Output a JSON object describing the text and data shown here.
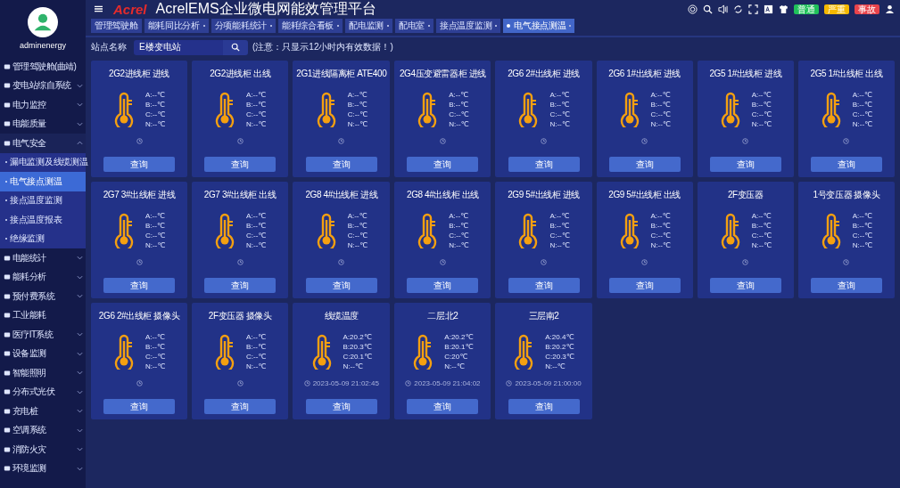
{
  "sidebar": {
    "user": "adminenergy",
    "items": [
      {
        "label": "管理驾驶舱(曲靖)",
        "expandable": false,
        "expanded": false
      },
      {
        "label": "变电站综自系统",
        "expandable": true,
        "expanded": false
      },
      {
        "label": "电力监控",
        "expandable": true,
        "expanded": false
      },
      {
        "label": "电能质量",
        "expandable": true,
        "expanded": false
      },
      {
        "label": "电气安全",
        "expandable": true,
        "expanded": true,
        "children": [
          {
            "label": "漏电监测及线缆测温",
            "selected": false
          },
          {
            "label": "电气接点测温",
            "selected": true
          },
          {
            "label": "接点温度监测",
            "selected": false
          },
          {
            "label": "接点温度报表",
            "selected": false
          },
          {
            "label": "绝缘监测",
            "selected": false
          }
        ]
      },
      {
        "label": "电能统计",
        "expandable": true,
        "expanded": false
      },
      {
        "label": "能耗分析",
        "expandable": true,
        "expanded": false
      },
      {
        "label": "预付费系统",
        "expandable": true,
        "expanded": false
      },
      {
        "label": "工业能耗",
        "expandable": false,
        "expanded": false
      },
      {
        "label": "医疗IT系统",
        "expandable": true,
        "expanded": false
      },
      {
        "label": "设备监测",
        "expandable": true,
        "expanded": false
      },
      {
        "label": "智能照明",
        "expandable": true,
        "expanded": false
      },
      {
        "label": "分布式光伏",
        "expandable": true,
        "expanded": false
      },
      {
        "label": "充电桩",
        "expandable": true,
        "expanded": false
      },
      {
        "label": "空调系统",
        "expandable": true,
        "expanded": false
      },
      {
        "label": "消防火灾",
        "expandable": true,
        "expanded": false
      },
      {
        "label": "环境监测",
        "expandable": true,
        "expanded": false
      }
    ]
  },
  "header": {
    "logo": "Acrel",
    "title": "AcrelEMS企业微电网能效管理平台",
    "alerts": [
      {
        "label": "普通",
        "color": "#1fc15a"
      },
      {
        "label": "严重",
        "color": "#f5b800"
      },
      {
        "label": "事故",
        "color": "#e8434b"
      }
    ]
  },
  "tabs": [
    {
      "label": "管理驾驶舱",
      "closable": false,
      "selected": false
    },
    {
      "label": "能耗同比分析",
      "closable": true,
      "selected": false
    },
    {
      "label": "分项能耗统计",
      "closable": true,
      "selected": false
    },
    {
      "label": "能耗综合看板",
      "closable": true,
      "selected": false
    },
    {
      "label": "配电监测",
      "closable": true,
      "selected": false
    },
    {
      "label": "配电室",
      "closable": true,
      "selected": false
    },
    {
      "label": "接点温度监测",
      "closable": true,
      "selected": false
    },
    {
      "label": "电气接点测温",
      "closable": true,
      "selected": true
    }
  ],
  "filter": {
    "label": "站点名称",
    "value": "E楼变电站",
    "note": "(注意：只显示12小时内有效数据！)"
  },
  "cards": [
    {
      "title": "2G2进线柜 进线",
      "readings": [
        "A:--℃",
        "B:--℃",
        "C:--℃",
        "N:--℃"
      ],
      "button": "查询"
    },
    {
      "title": "2G2进线柜 出线",
      "readings": [
        "A:--℃",
        "B:--℃",
        "C:--℃",
        "N:--℃"
      ],
      "button": "查询"
    },
    {
      "title": "2G1进线隔离柜 ATE400",
      "readings": [
        "A:--℃",
        "B:--℃",
        "C:--℃",
        "N:--℃"
      ],
      "button": "查询"
    },
    {
      "title": "2G4压变避雷器柜 进线",
      "readings": [
        "A:--℃",
        "B:--℃",
        "C:--℃",
        "N:--℃"
      ],
      "button": "查询"
    },
    {
      "title": "2G6 2#出线柜 进线",
      "readings": [
        "A:--℃",
        "B:--℃",
        "C:--℃",
        "N:--℃"
      ],
      "button": "查询"
    },
    {
      "title": "2G6 1#出线柜 进线",
      "readings": [
        "A:--℃",
        "B:--℃",
        "C:--℃",
        "N:--℃"
      ],
      "button": "查询"
    },
    {
      "title": "2G5 1#出线柜 进线",
      "readings": [
        "A:--℃",
        "B:--℃",
        "C:--℃",
        "N:--℃"
      ],
      "button": "查询"
    },
    {
      "title": "2G5 1#出线柜 出线",
      "readings": [
        "A:--℃",
        "B:--℃",
        "C:--℃",
        "N:--℃"
      ],
      "button": "查询"
    },
    {
      "title": "2G7 3#出线柜 进线",
      "readings": [
        "A:--℃",
        "B:--℃",
        "C:--℃",
        "N:--℃"
      ],
      "button": "查询"
    },
    {
      "title": "2G7 3#出线柜 出线",
      "readings": [
        "A:--℃",
        "B:--℃",
        "C:--℃",
        "N:--℃"
      ],
      "button": "查询"
    },
    {
      "title": "2G8 4#出线柜 进线",
      "readings": [
        "A:--℃",
        "B:--℃",
        "C:--℃",
        "N:--℃"
      ],
      "button": "查询"
    },
    {
      "title": "2G8 4#出线柜 出线",
      "readings": [
        "A:--℃",
        "B:--℃",
        "C:--℃",
        "N:--℃"
      ],
      "button": "查询"
    },
    {
      "title": "2G9 5#出线柜 进线",
      "readings": [
        "A:--℃",
        "B:--℃",
        "C:--℃",
        "N:--℃"
      ],
      "button": "查询"
    },
    {
      "title": "2G9 5#出线柜 出线",
      "readings": [
        "A:--℃",
        "B:--℃",
        "C:--℃",
        "N:--℃"
      ],
      "button": "查询"
    },
    {
      "title": "2F变压器",
      "readings": [
        "A:--℃",
        "B:--℃",
        "C:--℃",
        "N:--℃"
      ],
      "button": "查询"
    },
    {
      "title": "1号变压器 摄像头",
      "readings": [
        "A:--℃",
        "B:--℃",
        "C:--℃",
        "N:--℃"
      ],
      "button": "查询"
    },
    {
      "title": "2G6 2#出线柜 摄像头",
      "readings": [
        "A:--℃",
        "B:--℃",
        "C:--℃",
        "N:--℃"
      ],
      "button": "查询"
    },
    {
      "title": "2F变压器 摄像头",
      "readings": [
        "A:--℃",
        "B:--℃",
        "C:--℃",
        "N:--℃"
      ],
      "button": "查询"
    },
    {
      "title": "线缆温度",
      "readings": [
        "A:20.2℃",
        "B:20.3℃",
        "C:20.1℃",
        "N:--℃"
      ],
      "time": "2023-05-09 21:02:45",
      "button": "查询"
    },
    {
      "title": "二层北2",
      "readings": [
        "A:20.2℃",
        "B:20.1℃",
        "C:20℃",
        "N:--℃"
      ],
      "time": "2023-05-09 21:04:02",
      "button": "查询"
    },
    {
      "title": "三层南2",
      "readings": [
        "A:20.4℃",
        "B:20.2℃",
        "C:20.3℃",
        "N:--℃"
      ],
      "time": "2023-05-09 21:00:00",
      "button": "查询"
    }
  ]
}
